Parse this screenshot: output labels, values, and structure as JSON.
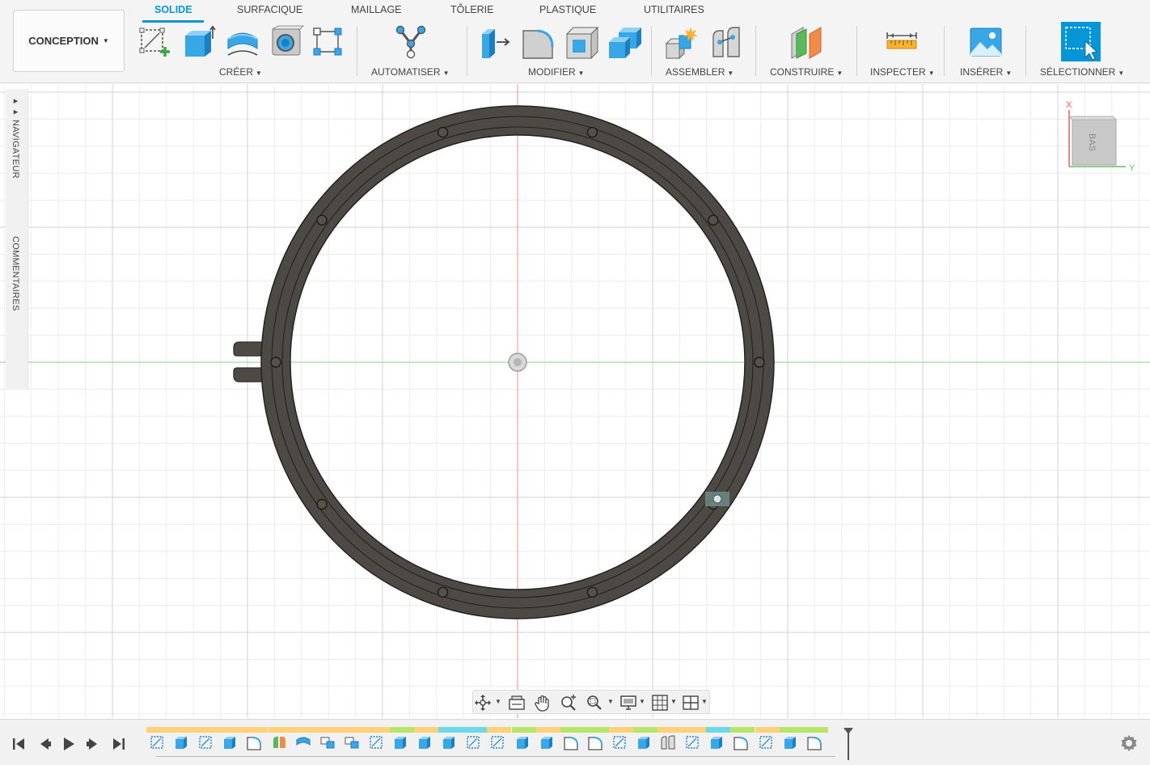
{
  "app": {
    "workspace": "CONCEPTION"
  },
  "tabs": [
    {
      "label": "SOLIDE",
      "active": true
    },
    {
      "label": "SURFACIQUE",
      "active": false
    },
    {
      "label": "MAILLAGE",
      "active": false
    },
    {
      "label": "TÔLERIE",
      "active": false
    },
    {
      "label": "PLASTIQUE",
      "active": false
    },
    {
      "label": "UTILITAIRES",
      "active": false
    }
  ],
  "groups": {
    "create": {
      "label": "CRÉER",
      "tools": [
        "sketch-icon",
        "extrude-icon",
        "revolve-icon",
        "hole-icon",
        "pattern-icon"
      ]
    },
    "automate": {
      "label": "AUTOMATISER",
      "tools": [
        "automate-icon"
      ]
    },
    "modify": {
      "label": "MODIFIER",
      "tools": [
        "press-pull-icon",
        "fillet-icon",
        "shell-icon",
        "combine-icon"
      ]
    },
    "assemble": {
      "label": "ASSEMBLER",
      "tools": [
        "new-component-icon",
        "joint-icon"
      ]
    },
    "construct": {
      "label": "CONSTRUIRE",
      "tools": [
        "offset-plane-icon"
      ]
    },
    "inspect": {
      "label": "INSPECTER",
      "tools": [
        "measure-icon"
      ]
    },
    "insert": {
      "label": "INSÉRER",
      "tools": [
        "insert-image-icon"
      ]
    },
    "select": {
      "label": "SÉLECTIONNER",
      "tools": [
        "select-icon"
      ]
    }
  },
  "side_panel": {
    "navigator": "NAVIGATEUR",
    "comments": "COMMENTAIRES"
  },
  "viewcube": {
    "face": "BAS",
    "axis_x": "X",
    "axis_y": "Y"
  },
  "navbar": {
    "tools": [
      "orbit-icon",
      "look-at-icon",
      "pan-icon",
      "zoom-icon",
      "fit-icon",
      "display-settings-icon",
      "grid-settings-icon",
      "viewports-icon"
    ]
  },
  "timeline": {
    "controls": [
      "go-to-start-icon",
      "step-back-icon",
      "play-icon",
      "step-forward-icon",
      "go-to-end-icon"
    ],
    "features": [
      "sketch",
      "extrude",
      "sketch",
      "extrude",
      "fillet",
      "split",
      "shell",
      "component",
      "component",
      "sketch",
      "extrude",
      "extrude",
      "extrude",
      "sketch",
      "sketch",
      "extrude",
      "extrude",
      "fillet",
      "fillet",
      "sketch",
      "extrude",
      "joint",
      "sketch",
      "extrude",
      "fillet",
      "sketch",
      "extrude",
      "fillet"
    ],
    "colors": {
      "yellow": "#ffd27a",
      "green": "#b9e46a",
      "cyan": "#6fd8e6"
    }
  },
  "colors": {
    "accent": "#0696d7",
    "ring": "#4d4a45",
    "axis_red": "#f08c8c",
    "axis_green": "#8ad68a"
  }
}
